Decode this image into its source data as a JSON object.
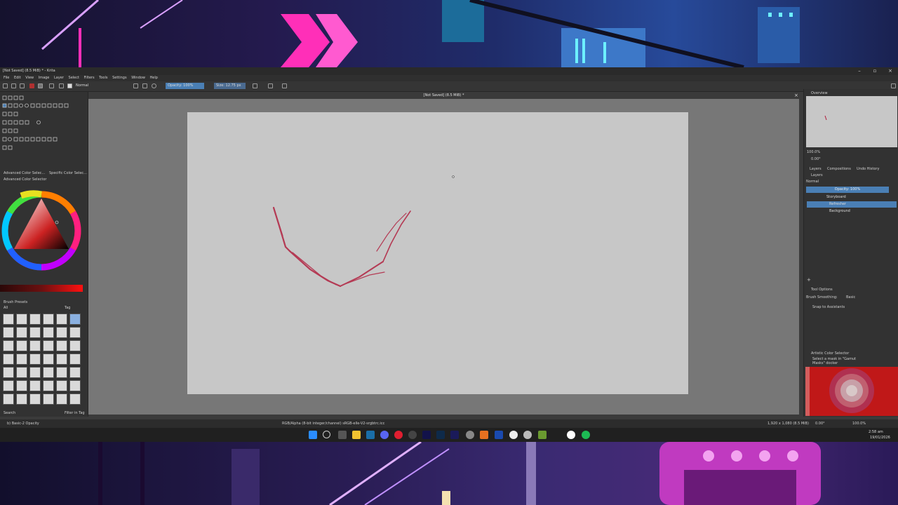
{
  "window": {
    "title": "[Not Saved] (8.5 MiB) * - Krita",
    "controls": {
      "minimize": "–",
      "maximize": "▫",
      "close": "×"
    }
  },
  "menu": [
    "File",
    "Edit",
    "View",
    "Image",
    "Layer",
    "Select",
    "Filters",
    "Tools",
    "Settings",
    "Window",
    "Help"
  ],
  "toolbar": {
    "blend_mode": "Normal",
    "opacity": "Opacity: 100%",
    "size": "Size: 12.75 px"
  },
  "left_dock": {
    "color_tabs": [
      "Advanced Color Selec...",
      "Specific Color Selec..."
    ],
    "color_panel_title": "Advanced Color Selector",
    "brush_presets_title": "Brush Presets",
    "brush_filter": "All",
    "brush_tag": "Tag",
    "search_placeholder": "Search",
    "filter_in_tag": "Filter in Tag"
  },
  "canvas": {
    "doc_title": "[Not Saved] (8.5 MiB) *"
  },
  "right_dock": {
    "overview_title": "Overview",
    "zoom": "100.0%",
    "rotation": "0.00°",
    "tabs": [
      "Layers",
      "Compositions",
      "Undo History"
    ],
    "layers_title": "Layers",
    "blend_mode": "Normal",
    "opacity": "Opacity: 100%",
    "layers": [
      "Storyboard",
      "Refresher",
      "Background"
    ],
    "tool_options_title": "Tool Options",
    "brush_smoothing_label": "Brush Smoothing:",
    "brush_smoothing_value": "Basic",
    "snap_label": "Snap to Assistants",
    "artistic_title": "Artistic Color Selector",
    "gamut_hint": "Select a mask in \"Gamut Masks\" docker"
  },
  "status": {
    "left": "b) Basic-2 Opacity",
    "center": "RGB/Alpha (8-bit integer/channel)  sRGB-elle-V2-srgbtrc.icc",
    "dims": "1,920 x 1,080 (8.5 MiB)",
    "rotation": "0.00°",
    "zoom": "100.0%"
  },
  "taskbar": {
    "time": "2:58 am",
    "date": "19/01/2026"
  },
  "colors": {
    "stroke": "#b01838",
    "accent": "#4a7fb5",
    "paper": "#c7c7c7"
  }
}
